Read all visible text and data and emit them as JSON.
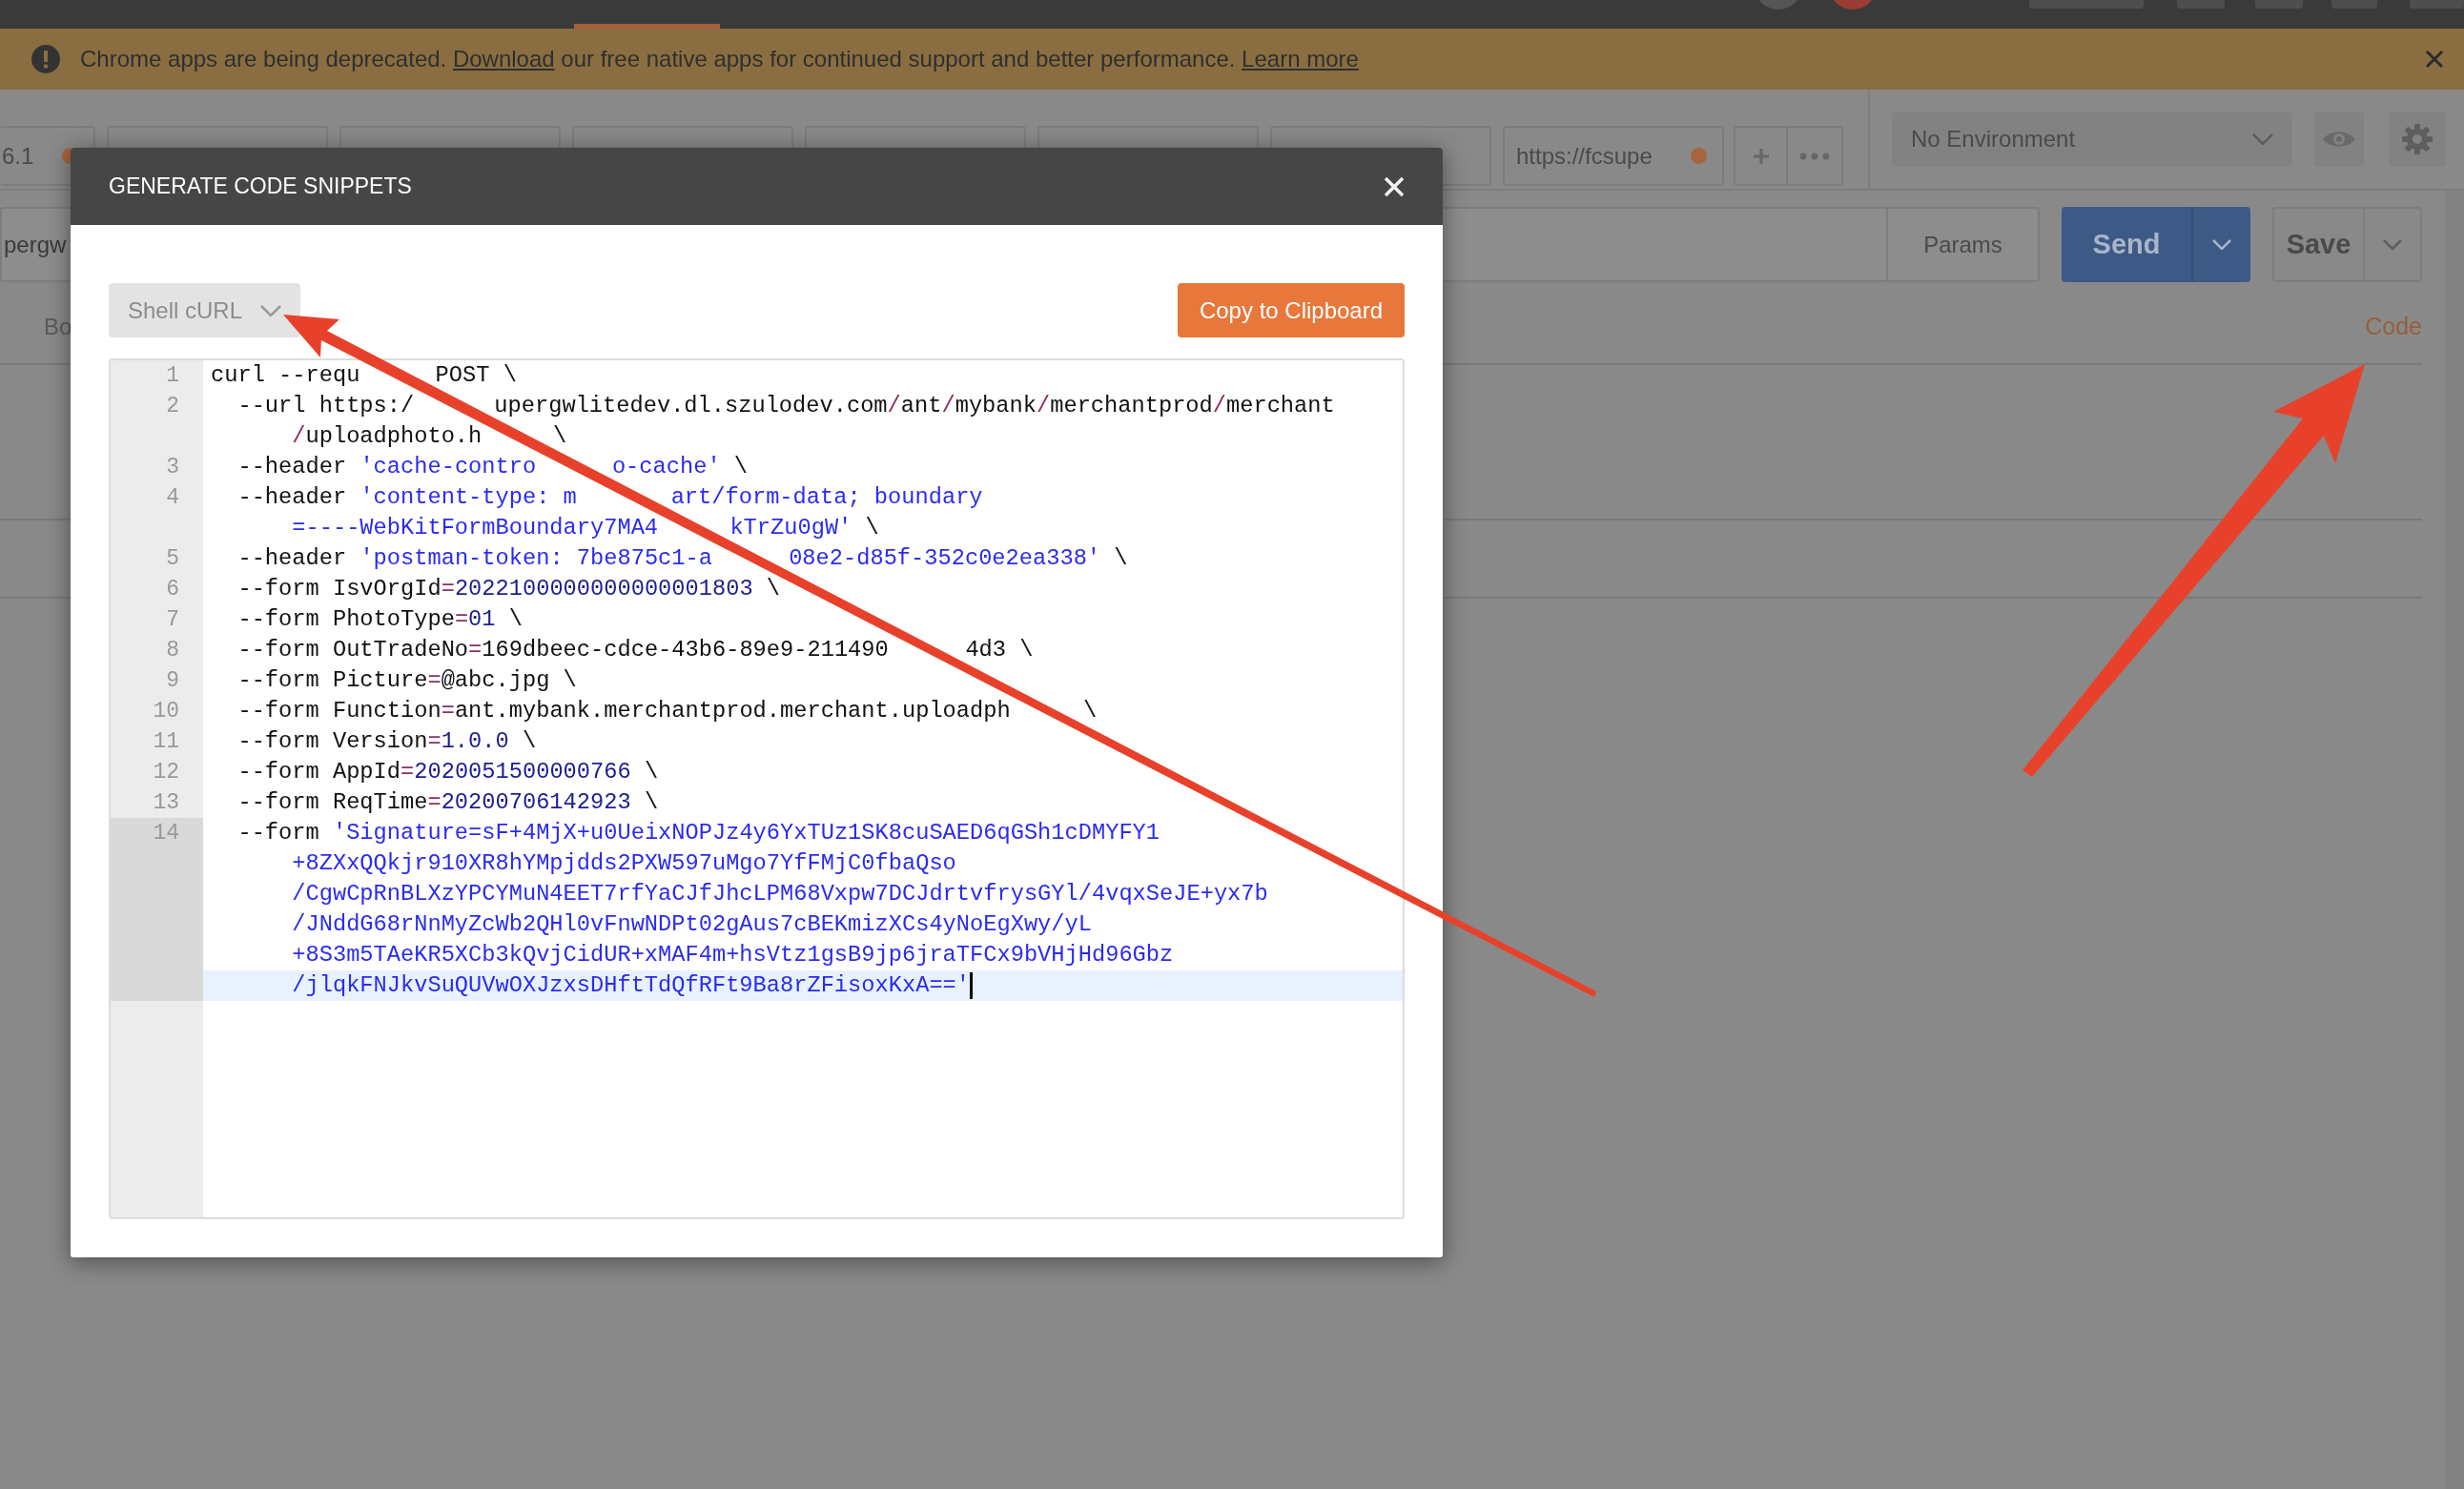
{
  "banner": {
    "message": [
      {
        "text": "Chrome apps are being deprecated. "
      },
      {
        "link": "Download"
      },
      {
        "text": " our free native apps for continued support and better performance. "
      },
      {
        "link": "Learn more"
      }
    ]
  },
  "tabs": [
    {
      "label": "6.1",
      "unsaved": true
    },
    {
      "unsaved": false
    },
    {
      "label": "https://fcsupe",
      "unsaved": true
    }
  ],
  "environment": {
    "value": "No Environment"
  },
  "request": {
    "url": "pergw",
    "params_button": "Params",
    "send_button": "Send",
    "save_button": "Save",
    "body_tab": "Bo",
    "code_link": "Code"
  },
  "modal": {
    "title": "GENERATE CODE SNIPPETS",
    "language": "Shell cURL",
    "copy_button": "Copy to Clipboard",
    "code_lines": [
      {
        "number": "1",
        "active": false,
        "rows": [
          [
            [
              {
                "kind": "plain",
                "text": "curl --requ"
              }
            ],
            [
              {
                "kind": "plain",
                "text": "POST \\"
              }
            ]
          ]
        ]
      },
      {
        "number": "2",
        "active": false,
        "rows": [
          [
            [
              {
                "kind": "plain",
                "text": "  --url https:/"
              }
            ],
            [
              {
                "kind": "plain",
                "text": "upergwlitedev.dl.szulodev.com"
              },
              {
                "kind": "op",
                "text": "/"
              },
              {
                "kind": "plain",
                "text": "ant"
              },
              {
                "kind": "op",
                "text": "/"
              },
              {
                "kind": "plain",
                "text": "mybank"
              },
              {
                "kind": "op",
                "text": "/"
              },
              {
                "kind": "plain",
                "text": "merchantprod"
              },
              {
                "kind": "op",
                "text": "/"
              },
              {
                "kind": "plain",
                "text": "merchant"
              }
            ]
          ],
          [
            [
              {
                "kind": "op",
                "text": "/"
              },
              {
                "kind": "plain",
                "text": "uploadphoto.h"
              }
            ],
            [
              {
                "kind": "plain",
                "text": "\\"
              }
            ]
          ]
        ]
      },
      {
        "number": "3",
        "active": false,
        "rows": [
          [
            [
              {
                "kind": "plain",
                "text": "  --header "
              },
              {
                "kind": "string",
                "text": "'cache-contro"
              }
            ],
            [
              {
                "kind": "string",
                "text": "o-cache'"
              },
              {
                "kind": "plain",
                "text": " \\"
              }
            ]
          ]
        ]
      },
      {
        "number": "4",
        "active": false,
        "rows": [
          [
            [
              {
                "kind": "plain",
                "text": "  --header "
              },
              {
                "kind": "string",
                "text": "'content-type: m"
              }
            ],
            [
              {
                "kind": "string",
                "text": "art/form-data; boundary"
              }
            ]
          ],
          [
            [
              {
                "kind": "string",
                "text": "=----WebKitFormBoundary7MA4"
              }
            ],
            [
              {
                "kind": "string",
                "text": "kTrZu0gW'"
              },
              {
                "kind": "plain",
                "text": " \\"
              }
            ]
          ]
        ]
      },
      {
        "number": "5",
        "active": false,
        "rows": [
          [
            [
              {
                "kind": "plain",
                "text": "  --header "
              },
              {
                "kind": "string",
                "text": "'postman-token: 7be875c1-a"
              }
            ],
            [
              {
                "kind": "string",
                "text": "08e2-d85f-352c0e2ea338'"
              },
              {
                "kind": "plain",
                "text": " \\"
              }
            ]
          ]
        ]
      },
      {
        "number": "6",
        "active": false,
        "rows": [
          [
            [
              {
                "kind": "plain",
                "text": "  --form IsvOrgId"
              },
              {
                "kind": "op",
                "text": "="
              },
              {
                "kind": "number",
                "text": "2022100000000000001803"
              },
              {
                "kind": "plain",
                "text": " \\"
              }
            ]
          ]
        ]
      },
      {
        "number": "7",
        "active": false,
        "rows": [
          [
            [
              {
                "kind": "plain",
                "text": "  --form PhotoType"
              },
              {
                "kind": "op",
                "text": "="
              },
              {
                "kind": "number",
                "text": "01"
              },
              {
                "kind": "plain",
                "text": " \\"
              }
            ]
          ]
        ]
      },
      {
        "number": "8",
        "active": false,
        "rows": [
          [
            [
              {
                "kind": "plain",
                "text": "  --form OutTradeNo"
              },
              {
                "kind": "op",
                "text": "="
              },
              {
                "kind": "plain",
                "text": "169dbeec-cdce-43b6-89e9-211490"
              }
            ],
            [
              {
                "kind": "plain",
                "text": "4d3 \\"
              }
            ]
          ]
        ]
      },
      {
        "number": "9",
        "active": false,
        "rows": [
          [
            [
              {
                "kind": "plain",
                "text": "  --form Picture"
              },
              {
                "kind": "op",
                "text": "="
              },
              {
                "kind": "plain",
                "text": "@abc.jpg \\"
              }
            ]
          ]
        ]
      },
      {
        "number": "10",
        "active": false,
        "rows": [
          [
            [
              {
                "kind": "plain",
                "text": "  --form Function"
              },
              {
                "kind": "op",
                "text": "="
              },
              {
                "kind": "plain",
                "text": "ant.mybank.merchantprod.merchant.uploadph"
              }
            ],
            [
              {
                "kind": "plain",
                "text": "\\"
              }
            ]
          ]
        ]
      },
      {
        "number": "11",
        "active": false,
        "rows": [
          [
            [
              {
                "kind": "plain",
                "text": "  --form Version"
              },
              {
                "kind": "op",
                "text": "="
              },
              {
                "kind": "number",
                "text": "1.0.0"
              },
              {
                "kind": "plain",
                "text": " \\"
              }
            ]
          ]
        ]
      },
      {
        "number": "12",
        "active": false,
        "rows": [
          [
            [
              {
                "kind": "plain",
                "text": "  --form AppId"
              },
              {
                "kind": "op",
                "text": "="
              },
              {
                "kind": "number",
                "text": "2020051500000766"
              },
              {
                "kind": "plain",
                "text": " \\"
              }
            ]
          ]
        ]
      },
      {
        "number": "13",
        "active": false,
        "rows": [
          [
            [
              {
                "kind": "plain",
                "text": "  --form ReqTime"
              },
              {
                "kind": "op",
                "text": "="
              },
              {
                "kind": "number",
                "text": "20200706142923"
              },
              {
                "kind": "plain",
                "text": " \\"
              }
            ]
          ]
        ]
      },
      {
        "number": "14",
        "active": true,
        "rows": [
          [
            [
              {
                "kind": "plain",
                "text": "  --form "
              },
              {
                "kind": "string",
                "text": "'Signature=sF+4MjX+u0UeixNOPJz4y6YxTUz1SK8cuSAED6qGSh1cDMYFY1"
              }
            ]
          ],
          [
            [
              {
                "kind": "string",
                "text": "+8ZXxQQkjr910XR8hYMpjdds2PXW597uMgo7YfFMjC0fbaQso"
              }
            ]
          ],
          [
            [
              {
                "kind": "string",
                "text": "/CgwCpRnBLXzYPCYMuN4EET7rfYaCJfJhcLPM68Vxpw7DCJdrtvfrysGYl/4vqxSeJE+yx7b"
              }
            ]
          ],
          [
            [
              {
                "kind": "string",
                "text": "/JNddG68rNnMyZcWb2QHl0vFnwNDPt02gAus7cBEKmizXCs4yNoEgXwy/yL"
              }
            ]
          ],
          [
            [
              {
                "kind": "string",
                "text": "+8S3m5TAeKR5XCb3kQvjCidUR+xMAF4m+hsVtz1gsB9jp6jraTFCx9bVHjHd96Gbz"
              }
            ]
          ],
          [
            [
              {
                "kind": "string",
                "text": "/jlqkFNJkvSuQUVwOXJzxsDHftTdQfRFt9Ba8rZFisoxKxA=='"
              }
            ]
          ]
        ]
      }
    ]
  }
}
